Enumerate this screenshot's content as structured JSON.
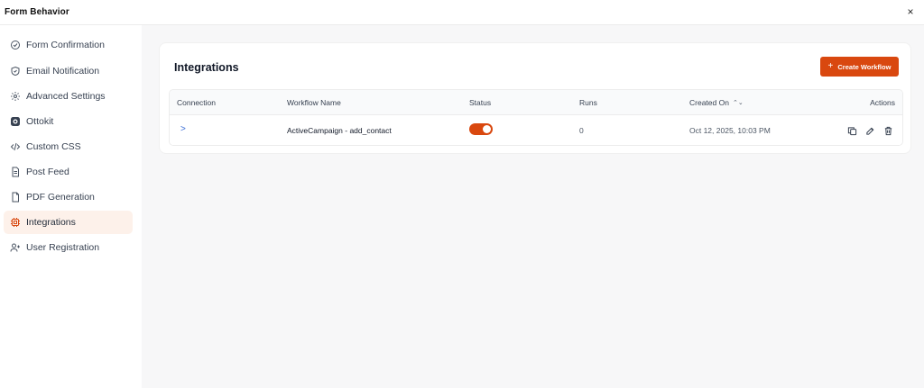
{
  "header": {
    "title": "Form Behavior",
    "close_icon": "close-icon",
    "close_glyph": "×"
  },
  "sidebar": {
    "items": [
      {
        "label": "Form Confirmation",
        "icon": "check-circle-icon",
        "active": false
      },
      {
        "label": "Email Notification",
        "icon": "shield-icon",
        "active": false
      },
      {
        "label": "Advanced Settings",
        "icon": "gear-icon",
        "active": false
      },
      {
        "label": "Ottokit",
        "icon": "ottokit-icon",
        "active": false
      },
      {
        "label": "Custom CSS",
        "icon": "code-icon",
        "active": false
      },
      {
        "label": "Post Feed",
        "icon": "document-icon",
        "active": false
      },
      {
        "label": "PDF Generation",
        "icon": "file-icon",
        "active": false
      },
      {
        "label": "Integrations",
        "icon": "integrations-icon",
        "active": true
      },
      {
        "label": "User Registration",
        "icon": "user-plus-icon",
        "active": false
      }
    ]
  },
  "main": {
    "title": "Integrations",
    "create_button": {
      "label": "Create Workflow",
      "plus": "+"
    },
    "table": {
      "columns": [
        "Connection",
        "Workflow Name",
        "Status",
        "Runs",
        "Created On",
        "Actions"
      ],
      "sort_glyph": "⌃⌄",
      "rows": [
        {
          "expand_glyph": ">",
          "workflow_name": "ActiveCampaign - add_contact",
          "status_on": true,
          "runs": "0",
          "created_on": "Oct 12, 2025, 10:03 PM",
          "actions": [
            "copy-icon",
            "edit-icon",
            "trash-icon"
          ]
        }
      ]
    }
  },
  "colors": {
    "accent": "#d9480f",
    "active_bg": "#fdf1ea",
    "main_bg": "#f7f7f8"
  }
}
